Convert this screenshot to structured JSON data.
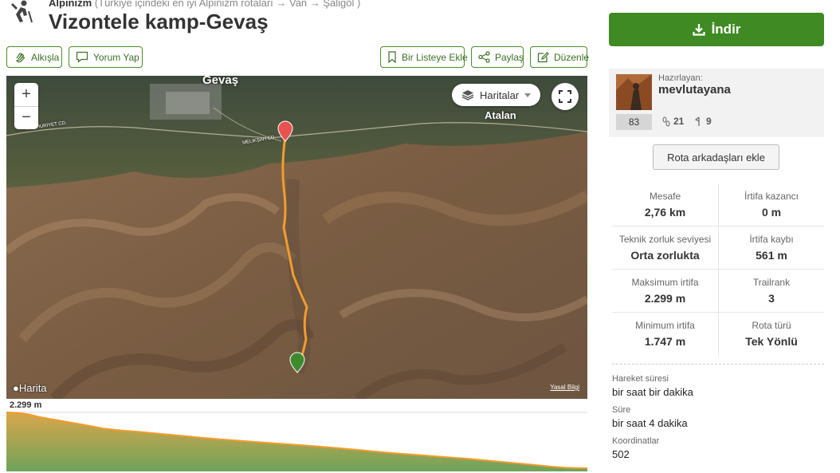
{
  "header": {
    "category": "Alpinizm",
    "breadcrumb_rest": "(Türkiye içindeki en iyi Alpinizm rotaları → Van → Şaligöl )",
    "title": "Vizontele kamp-Gevaş"
  },
  "actions": {
    "clap": "Alkışla",
    "comment": "Yorum Yap",
    "add_to_list": "Bir Listeye Ekle",
    "share": "Paylaş",
    "edit": "Düzenle"
  },
  "map": {
    "zoom_in": "+",
    "zoom_out": "−",
    "layers_label": "Haritalar",
    "place_gevas": "Gevaş",
    "place_atalan": "Atalan",
    "attribution": "Harita",
    "legal": "Yasal Bilgi",
    "road_1": "CUMHURIYET CD.",
    "road_2": "MELIKŞAH CD."
  },
  "elevation": {
    "max_label": "2.299 m",
    "profile": [
      2299,
      2295,
      2280,
      2255,
      2235,
      2218,
      2198,
      2180,
      2160,
      2140,
      2128,
      2118,
      2110,
      2100,
      2090,
      2080,
      2070,
      2060,
      2050,
      2040,
      2032,
      2024,
      2016,
      2008,
      2000,
      1992,
      1985,
      1978,
      1970,
      1962,
      1953,
      1944,
      1935,
      1925,
      1915,
      1905,
      1896,
      1888,
      1880,
      1872,
      1864,
      1856,
      1848,
      1840,
      1830,
      1820,
      1810,
      1800,
      1790,
      1780,
      1770,
      1760,
      1752,
      1748,
      1747
    ]
  },
  "sidebar": {
    "download_label": "İndir",
    "prepared_by_label": "Hazırlayan:",
    "username": "mevlutayana",
    "rank": "83",
    "followers": "21",
    "routes": "9",
    "add_partners_label": "Rota arkadaşları ekle",
    "stats": [
      [
        {
          "label": "Mesafe",
          "value": "2,76 km"
        },
        {
          "label": "İrtifa kazancı",
          "value": "0 m"
        }
      ],
      [
        {
          "label": "Teknik zorluk seviyesi",
          "value": "Orta zorlukta"
        },
        {
          "label": "İrtifa kaybı",
          "value": "561 m"
        }
      ],
      [
        {
          "label": "Maksimum irtifa",
          "value": "2.299 m"
        },
        {
          "label": "Trailrank",
          "value": "3"
        }
      ],
      [
        {
          "label": "Minimum irtifa",
          "value": "1.747 m"
        },
        {
          "label": "Rota türü",
          "value": "Tek Yönlü"
        }
      ]
    ],
    "details": [
      {
        "label": "Hareket süresi",
        "value": "bir saat bir dakika"
      },
      {
        "label": "Süre",
        "value": "bir saat 4 dakika"
      },
      {
        "label": "Koordinatlar",
        "value": "502"
      }
    ]
  },
  "colors": {
    "brand_green": "#3f8a23",
    "route_orange": "#f39c2d",
    "start_pin": "#e8534f",
    "end_pin": "#3d8b2d"
  }
}
